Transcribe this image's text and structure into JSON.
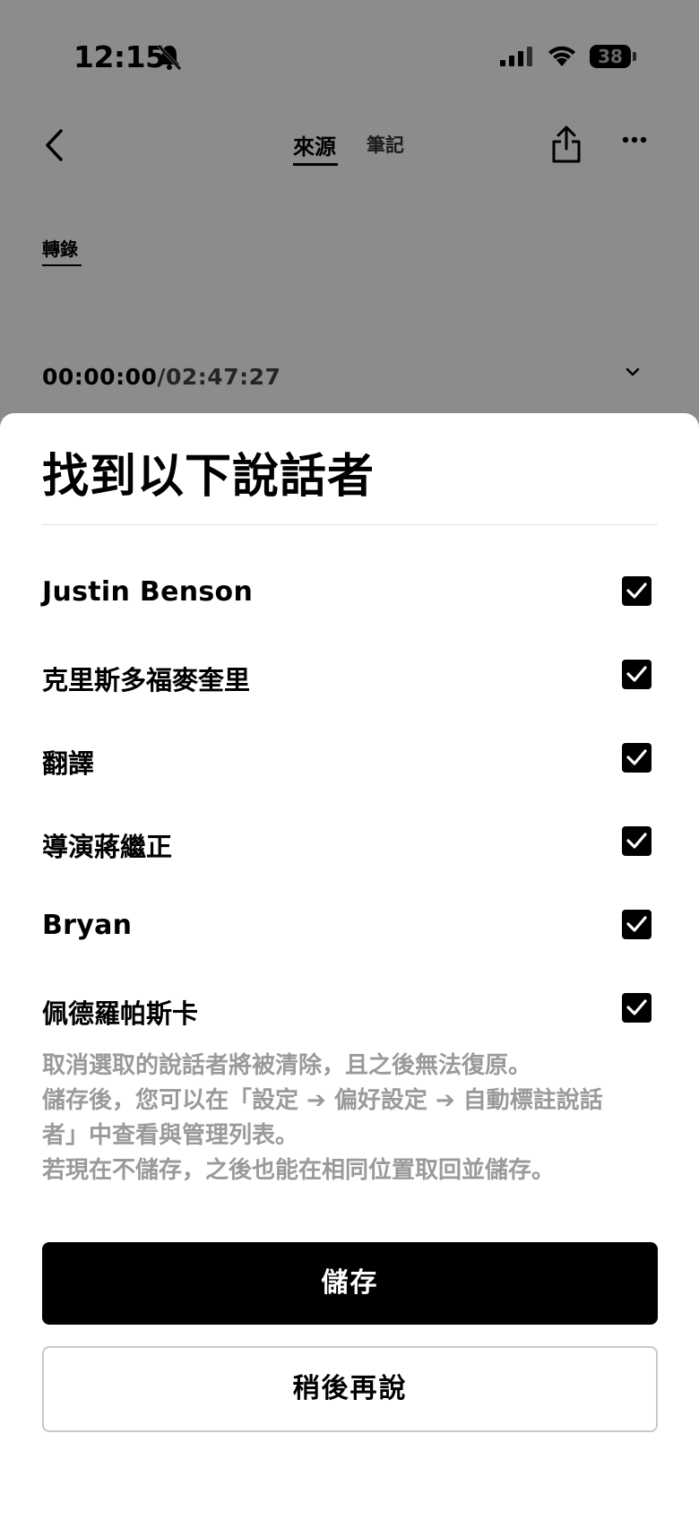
{
  "status_bar": {
    "time": "12:15",
    "battery": "38",
    "icons": [
      "bell-slash-icon",
      "signal-icon",
      "wifi-icon",
      "battery-icon"
    ]
  },
  "nav": {
    "tabs": [
      {
        "label": "來源",
        "active": true
      },
      {
        "label": "筆記",
        "active": false
      }
    ],
    "icons": [
      "back-icon",
      "share-icon",
      "more-icon"
    ]
  },
  "content": {
    "sub_tab": "轉錄",
    "time_current": "00:00:00",
    "time_separator": "/",
    "time_total": "02:47:27"
  },
  "sheet": {
    "title": "找到以下說話者",
    "speakers": [
      {
        "name": "Justin Benson",
        "checked": true
      },
      {
        "name": "克里斯多福麥奎里",
        "checked": true
      },
      {
        "name": "翻譯",
        "checked": true
      },
      {
        "name": "導演蔣繼正",
        "checked": true
      },
      {
        "name": "Bryan",
        "checked": true
      },
      {
        "name": "佩德羅帕斯卡",
        "checked": true
      }
    ],
    "note_lines": [
      "取消選取的說話者將被清除，且之後無法復原。",
      "儲存後，您可以在「設定 ➔ 偏好設定 ➔ 自動標註說話",
      "者」中查看與管理列表。",
      "若現在不儲存，之後也能在相同位置取回並儲存。"
    ],
    "save_label": "儲存",
    "later_label": "稍後再說"
  },
  "colors": {
    "overlay": "#000000",
    "primary": "#000000",
    "note_text": "#9a9a9a"
  }
}
